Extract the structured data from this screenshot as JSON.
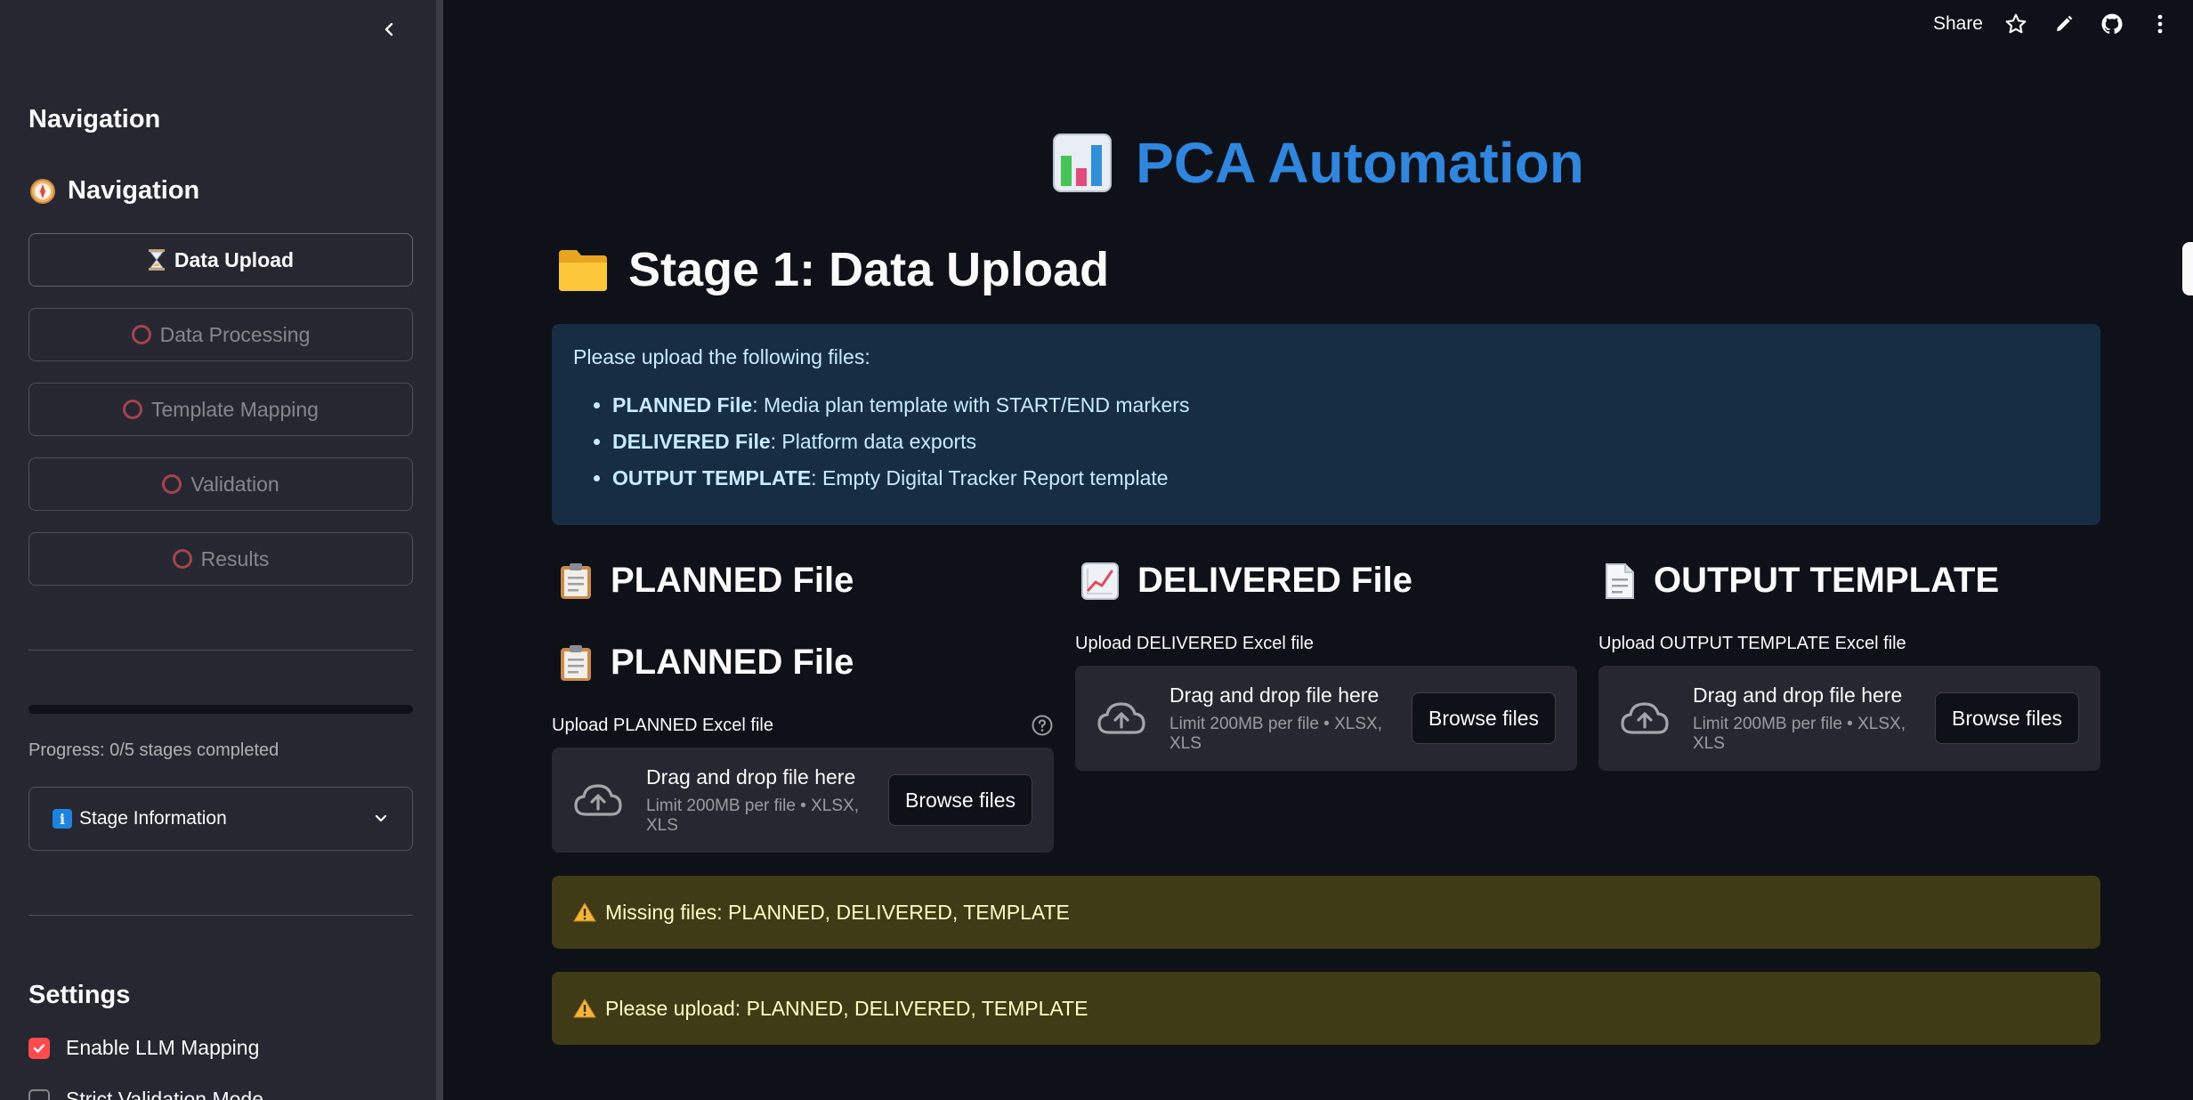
{
  "sidebar": {
    "heading": "Navigation",
    "nav_heading": "Navigation",
    "nav_heading_icon": "compass-icon",
    "nav_items": [
      {
        "label": "Data Upload",
        "icon": "hourglass-icon",
        "state": "active"
      },
      {
        "label": "Data Processing",
        "icon": "circle-icon",
        "state": "pending"
      },
      {
        "label": "Template Mapping",
        "icon": "circle-icon",
        "state": "pending"
      },
      {
        "label": "Validation",
        "icon": "circle-icon",
        "state": "pending"
      },
      {
        "label": "Results",
        "icon": "circle-icon",
        "state": "pending"
      }
    ],
    "progress_fraction": 0,
    "progress_text": "Progress: 0/5 stages completed",
    "expander_label": "Stage Information",
    "settings_heading": "Settings",
    "settings": [
      {
        "label": "Enable LLM Mapping",
        "checked": true
      },
      {
        "label": "Strict Validation Mode",
        "checked": false
      }
    ]
  },
  "header": {
    "share_label": "Share",
    "icons": [
      "star-icon",
      "pencil-icon",
      "github-icon",
      "more-vertical-icon"
    ]
  },
  "main": {
    "title": "PCA Automation",
    "title_icon": "bar-chart-icon",
    "stage_title": "Stage 1: Data Upload",
    "stage_icon": "folder-icon",
    "info": {
      "intro": "Please upload the following files:",
      "items": [
        {
          "bold": "PLANNED File",
          "text": ": Media plan template with START/END markers"
        },
        {
          "bold": "DELIVERED File",
          "text": ": Platform data exports"
        },
        {
          "bold": "OUTPUT TEMPLATE",
          "text": ": Empty Digital Tracker Report template"
        }
      ]
    },
    "columns": {
      "planned": {
        "heading": "PLANNED File",
        "subheading": "PLANNED File",
        "upload_label": "Upload PLANNED Excel file"
      },
      "delivered": {
        "heading": "DELIVERED File",
        "upload_label": "Upload DELIVERED Excel file"
      },
      "template": {
        "heading": "OUTPUT TEMPLATE",
        "upload_label": "Upload OUTPUT TEMPLATE Excel file"
      }
    },
    "dropzone": {
      "main_text": "Drag and drop file here",
      "limit_text": "Limit 200MB per file • XLSX, XLS",
      "browse_label": "Browse files"
    },
    "warnings": [
      "Missing files: PLANNED, DELIVERED, TEMPLATE",
      "Please upload: PLANNED, DELIVERED, TEMPLATE"
    ]
  },
  "colors": {
    "accent": "#ff4b4b",
    "title_blue": "#2e86de",
    "info_bg": "#172d43",
    "warning_bg": "#3e3b16"
  }
}
